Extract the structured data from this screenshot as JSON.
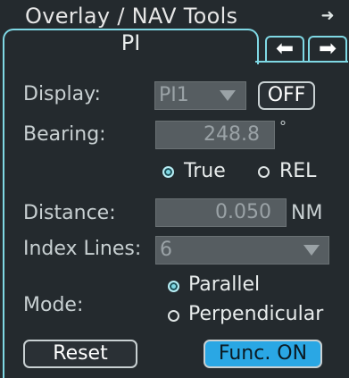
{
  "window": {
    "title": "Overlay / NAV Tools",
    "title_arrow_icon": "arrow-right-icon"
  },
  "tabs": {
    "active_label": "PI",
    "prev_icon": "arrow-left-icon",
    "next_icon": "arrow-right-icon"
  },
  "display": {
    "label": "Display:",
    "value": "PI1",
    "toggle_label": "OFF"
  },
  "bearing": {
    "label": "Bearing:",
    "value": "248.8",
    "unit": "°"
  },
  "bearing_ref": {
    "options": [
      "True",
      "REL"
    ],
    "selected": "True"
  },
  "distance": {
    "label": "Distance:",
    "value": "0.050",
    "unit": "NM"
  },
  "index_lines": {
    "label": "Index Lines:",
    "value": "6"
  },
  "mode": {
    "label": "Mode:",
    "options": [
      "Parallel",
      "Perpendicular"
    ],
    "selected": "Parallel"
  },
  "buttons": {
    "reset": "Reset",
    "func": "Func. ON"
  },
  "colors": {
    "accent": "#7fd8e4",
    "func_button": "#2aa7e4",
    "field_bg": "#565d61",
    "background": "#242a2e"
  }
}
